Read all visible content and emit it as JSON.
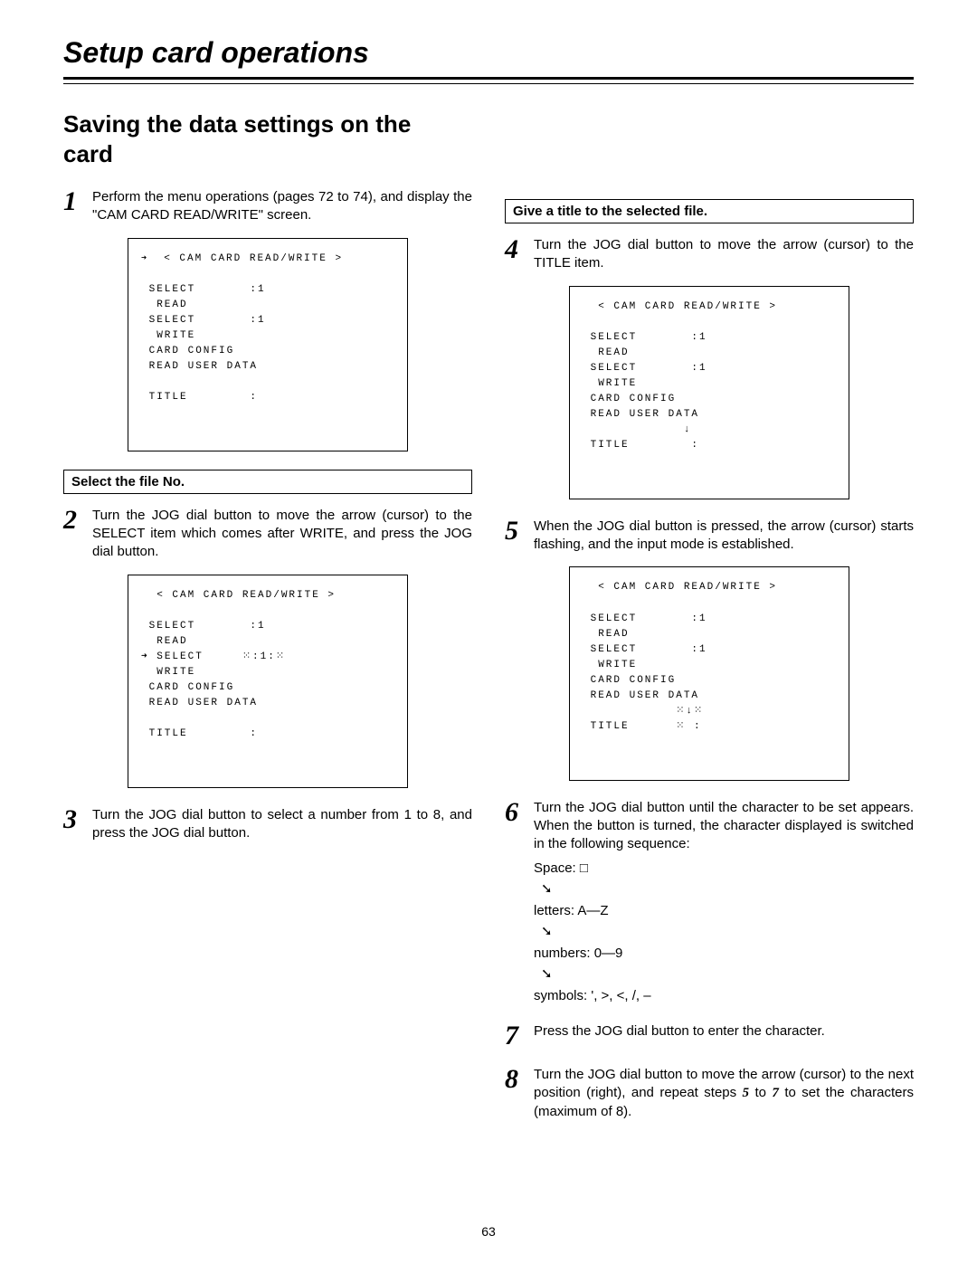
{
  "chapter_title": "Setup card operations",
  "section_title": "Saving the data settings on the card",
  "page_number": "63",
  "left_box_heading": "Select the file No.",
  "right_box_heading": "Give a title to the selected file.",
  "steps": {
    "s1": "Perform the menu operations (pages 72 to 74), and display the \"CAM CARD READ/WRITE\" screen.",
    "s2": "Turn the JOG dial button to move the arrow (cursor) to the SELECT item which comes after WRITE, and press the JOG dial button.",
    "s3": "Turn the JOG dial button to select a number from 1 to 8, and press the JOG dial button.",
    "s4": "Turn the JOG dial button to move the arrow (cursor) to the TITLE item.",
    "s5": "When the JOG dial button is pressed, the arrow (cursor) starts flashing, and the input mode is established.",
    "s6_a": "Turn the JOG dial button until the character to be set appears.  When the button is turned, the character displayed is switched in the following sequence:",
    "s6_seq_space": "Space: □",
    "s6_seq_letters": "letters: A—Z",
    "s6_seq_numbers": "numbers: 0—9",
    "s6_seq_symbols": "symbols: ', >, <, /, –",
    "s7": "Press the JOG dial button to enter the character.",
    "s8_a": "Turn the JOG dial button to move the arrow (cursor) to the next position (right), and repeat steps ",
    "s8_5": "5",
    "s8_b": " to ",
    "s8_7": "7",
    "s8_c": " to set the characters (maximum of 8)."
  },
  "screens": {
    "scr1": "  < CAM CARD READ/WRITE >\n\n SELECT       :1\n  READ\n SELECT       :1\n  WRITE\n CARD CONFIG\n READ USER DATA\n\n TITLE        :",
    "scr1_cursor_prefix": "➜",
    "scr2": "  < CAM CARD READ/WRITE >\n\n SELECT       :1\n  READ\n➜ SELECT     ⁙:1:⁙\n  WRITE\n CARD CONFIG\n READ USER DATA\n\n TITLE        :",
    "scr3": "  < CAM CARD READ/WRITE >\n\n SELECT       :1\n  READ\n SELECT       :1\n  WRITE\n CARD CONFIG\n READ USER DATA\n             ↓\n TITLE        :",
    "scr4": "  < CAM CARD READ/WRITE >\n\n SELECT       :1\n  READ\n SELECT       :1\n  WRITE\n CARD CONFIG\n READ USER DATA\n            ⁙↓⁙\n TITLE      ⁙ :"
  }
}
